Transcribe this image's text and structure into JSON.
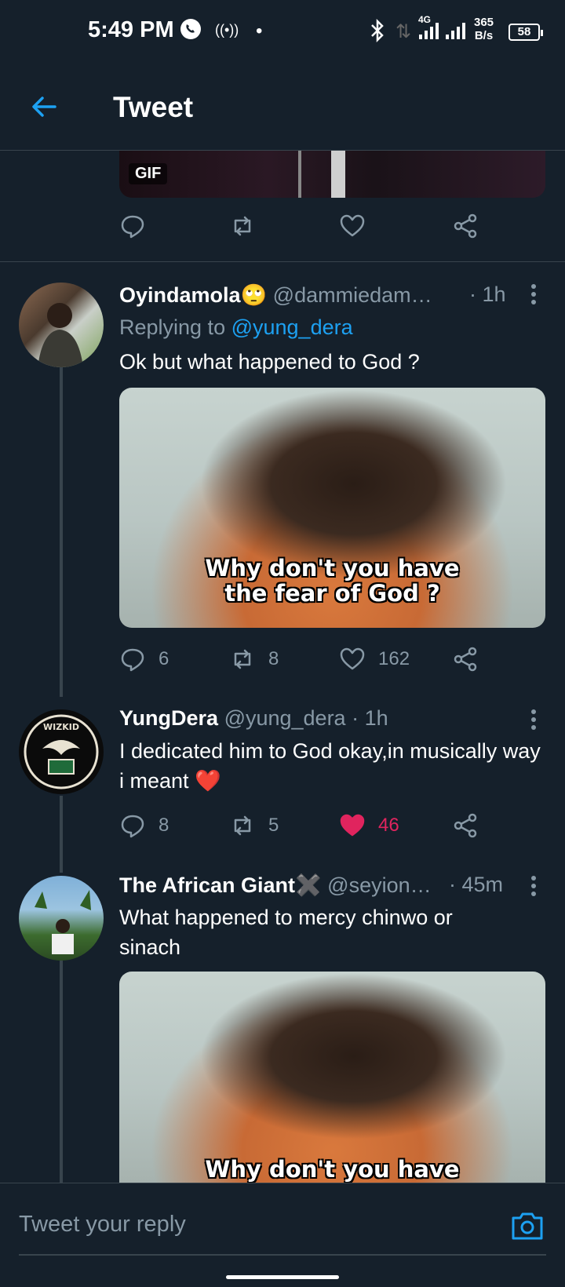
{
  "status_bar": {
    "time": "5:49 PM",
    "network": "4G",
    "speed_value": "365",
    "speed_unit": "B/s",
    "battery": "58"
  },
  "header": {
    "title": "Tweet"
  },
  "top_tweet": {
    "media_badge": "GIF"
  },
  "tweets": [
    {
      "name": "Oyindamola🙄",
      "handle": "@dammiedam…",
      "time": "· 1h",
      "replying_prefix": "Replying to ",
      "replying_to": "@yung_dera",
      "text": "Ok but what happened to God ?",
      "media_caption_1": "Why don't you have",
      "media_caption_2": "the fear of God ?",
      "replies": "6",
      "retweets": "8",
      "likes": "162"
    },
    {
      "name": "YungDera",
      "handle": "@yung_dera · 1h",
      "text": "I dedicated him to God okay,in musically way i meant ❤️",
      "replies": "8",
      "retweets": "5",
      "likes": "46",
      "liked": true
    },
    {
      "name": "The African Giant✖️",
      "handle": "@seyion…",
      "time": "· 45m",
      "text": "What happened to mercy chinwo or sinach",
      "media_caption_1": "Why don't you have"
    }
  ],
  "reply_bar": {
    "placeholder": "Tweet your reply"
  },
  "colors": {
    "background": "#15202b",
    "accent": "#1da1f2",
    "muted": "#8899a6",
    "like": "#e0245e",
    "divider": "#38444d"
  }
}
